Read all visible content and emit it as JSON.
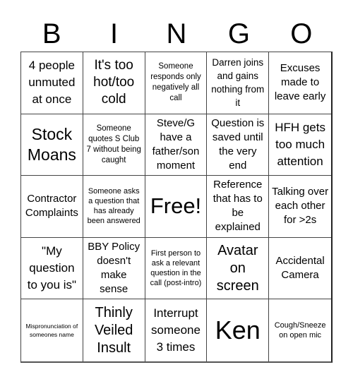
{
  "header": {
    "letters": [
      "B",
      "I",
      "N",
      "G",
      "O"
    ]
  },
  "card": {
    "rows": [
      [
        "4 people unmuted at once",
        "It's too hot/too cold",
        "Someone responds only negatively all call",
        "Darren joins and gains nothing from it",
        "Excuses made to leave early"
      ],
      [
        "Stock Moans",
        "Someone quotes S Club 7 without being caught",
        "Steve/G have a father/son moment",
        "Question is saved until the very end",
        "HFH gets too much attention"
      ],
      [
        "Contractor Complaints",
        "Someone asks a question that has already been answered",
        "Free!",
        "Reference that has to be explained",
        "Talking over each other for >2s"
      ],
      [
        "\"My question to you is\"",
        "BBY Policy doesn't make sense",
        "First person to ask a relevant question in the call (post-intro)",
        "Avatar on screen",
        "Accidental Camera"
      ],
      [
        "Mispronunciation of someones name",
        "Thinly Veiled Insult",
        "Interrupt someone 3 times",
        "Ken",
        "Cough/Sneeze on open mic"
      ]
    ],
    "free_space": "Free!"
  }
}
